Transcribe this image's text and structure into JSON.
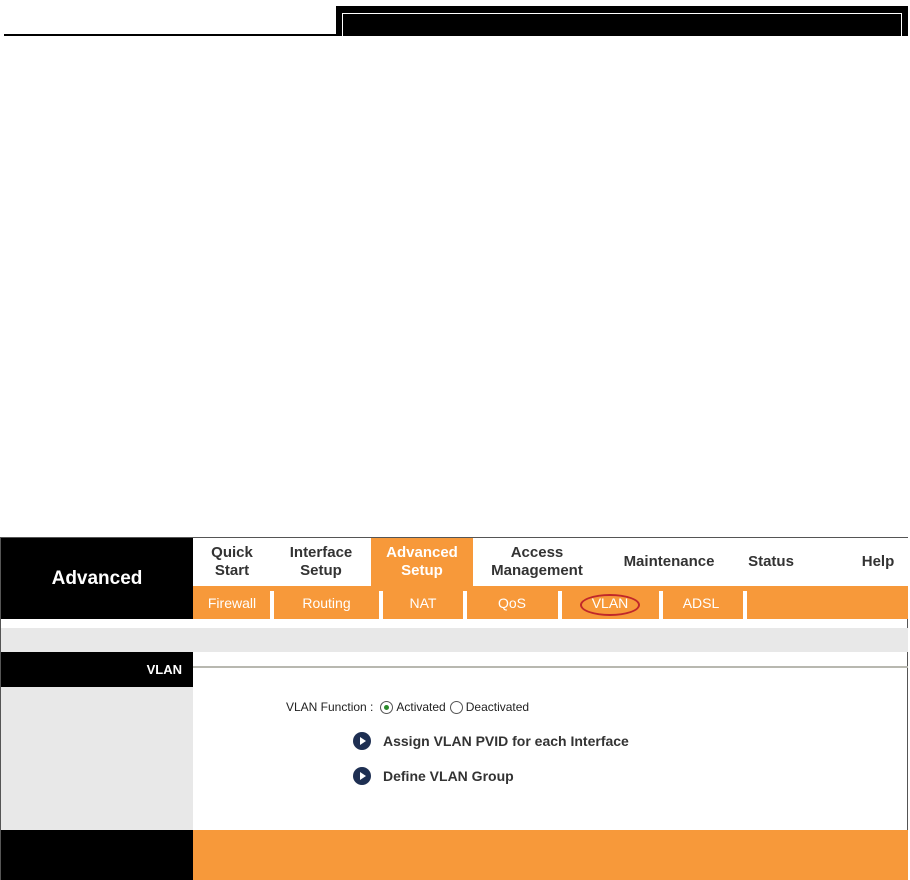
{
  "brand": {
    "title": "Advanced"
  },
  "main_nav": [
    {
      "id": "quick-start",
      "label": "Quick\nStart"
    },
    {
      "id": "interface-setup",
      "label": "Interface\nSetup"
    },
    {
      "id": "advanced-setup",
      "label": "Advanced\nSetup",
      "active": true
    },
    {
      "id": "access-management",
      "label": "Access\nManagement"
    },
    {
      "id": "maintenance",
      "label": "Maintenance"
    },
    {
      "id": "status",
      "label": "Status"
    },
    {
      "id": "help",
      "label": "Help"
    }
  ],
  "sub_nav": [
    {
      "id": "firewall",
      "label": "Firewall"
    },
    {
      "id": "routing",
      "label": "Routing"
    },
    {
      "id": "nat",
      "label": "NAT"
    },
    {
      "id": "qos",
      "label": "QoS"
    },
    {
      "id": "vlan",
      "label": "VLAN",
      "active": true
    },
    {
      "id": "adsl",
      "label": "ADSL"
    }
  ],
  "section": {
    "title": "VLAN"
  },
  "vlan_function": {
    "label": "VLAN Function :",
    "options": [
      "Activated",
      "Deactivated"
    ],
    "selected": "Activated"
  },
  "links": {
    "assign_pvid": "Assign VLAN PVID for each Interface",
    "define_group": "Define VLAN Group"
  },
  "colors": {
    "accent_orange": "#f7993a",
    "highlight_red": "#c0282a",
    "icon_navy": "#1e2f52"
  }
}
